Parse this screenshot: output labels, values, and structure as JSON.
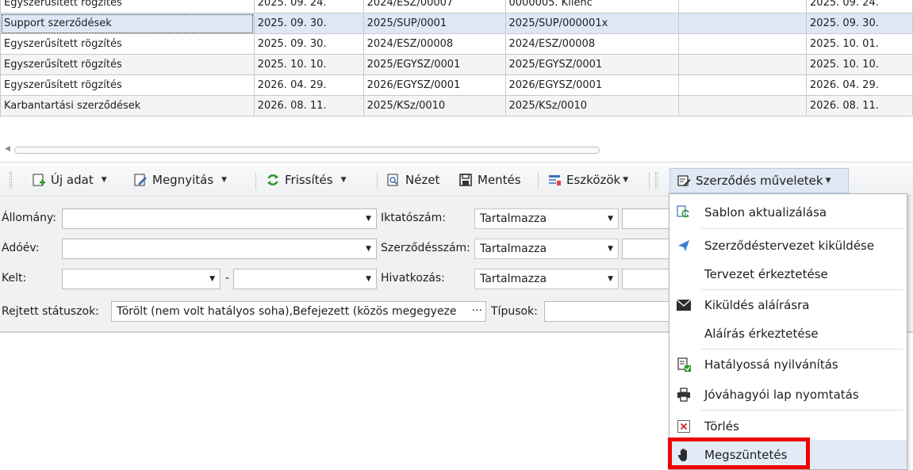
{
  "grid": {
    "rows": [
      [
        "Egyszerűsített rögzítés",
        "2025. 09. 24.",
        "2024/ESZ/00007",
        "0000005. Kilenc",
        "",
        "2025. 09. 24."
      ],
      [
        "Support szerződések",
        "2025. 09. 30.",
        "2025/SUP/0001",
        "2025/SUP/000001x",
        "",
        "2025. 09. 30."
      ],
      [
        "Egyszerűsített rögzítés",
        "2025. 09. 30.",
        "2024/ESZ/00008",
        "2024/ESZ/00008",
        "",
        "2025. 10. 01."
      ],
      [
        "Egyszerűsített rögzítés",
        "2025. 10. 10.",
        "2025/EGYSZ/0001",
        "2025/EGYSZ/0001",
        "",
        "2025. 10. 10."
      ],
      [
        "Egyszerűsített rögzítés",
        "2026. 04. 29.",
        "2026/EGYSZ/0001",
        "2026/EGYSZ/0001",
        "",
        "2026. 04. 29."
      ],
      [
        "Karbantartási szerződések",
        "2026. 08. 11.",
        "2025/KSz/0010",
        "2025/KSz/0010",
        "",
        "2026. 08. 11."
      ]
    ],
    "selected_row": 1
  },
  "toolbar": {
    "new_label": "Új adat",
    "open_label": "Megnyitás",
    "refresh_label": "Frissítés",
    "view_label": "Nézet",
    "save_label": "Mentés",
    "tools_label": "Eszközök",
    "contract_ops_label": "Szerződés műveletek"
  },
  "filters": {
    "allomany_label": "Állomány:",
    "adoev_label": "Adóév:",
    "kelt_label": "Kelt:",
    "kelt_separator": "-",
    "iktatoszam_label": "Iktatószám:",
    "szerzodesszam_label": "Szerződésszám:",
    "hivatkozas_label": "Hivatkozás:",
    "match_mode_1": "Tartalmazza",
    "match_mode_2": "Tartalmazza",
    "match_mode_3": "Tartalmazza",
    "hidden_status_label": "Rejtett státuszok:",
    "hidden_status_value": "Törölt (nem volt hatályos soha),Befejezett (közös megegyeze",
    "ellipsis": "···",
    "types_label": "Típusok:"
  },
  "menu": {
    "items": [
      {
        "label": "Sablon aktualizálása",
        "icon": "template-refresh-icon"
      },
      {
        "label": "Szerződéstervezet kiküldése",
        "icon": "send-plane-icon"
      },
      {
        "label": "Tervezet érkeztetése",
        "icon": ""
      },
      {
        "label": "Kiküldés aláírásra",
        "icon": "envelope-icon"
      },
      {
        "label": "Aláírás érkeztetése",
        "icon": ""
      },
      {
        "label": "Hatályossá nyilvánítás",
        "icon": "document-check-icon"
      },
      {
        "label": "Jóváhagyói lap nyomtatás",
        "icon": "printer-icon"
      },
      {
        "label": "Törlés",
        "icon": "delete-x-icon"
      },
      {
        "label": "Megszüntetés",
        "icon": "hand-stop-icon"
      }
    ],
    "hovered_index": 8
  },
  "colors": {
    "selected_row": "#dde7f5",
    "highlight_border": "#f00000",
    "refresh_green": "#2a9a2a",
    "accent_blue": "#3b6fb6"
  }
}
